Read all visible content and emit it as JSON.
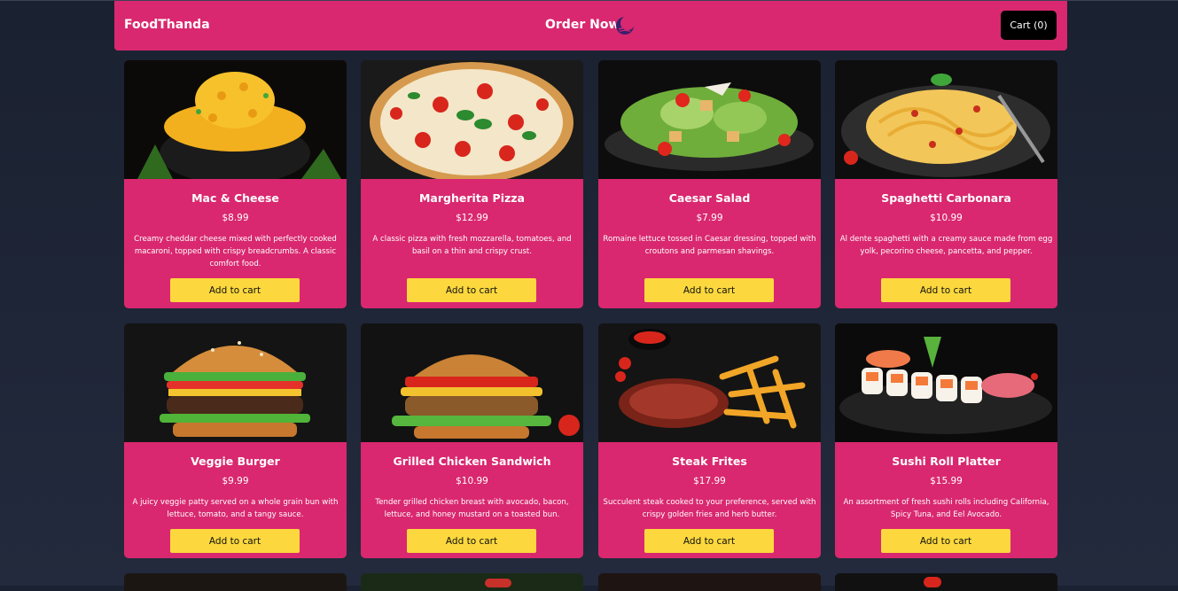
{
  "navbar": {
    "brand": "FoodThanda",
    "center_title": "Order Now",
    "cart_label": "Cart (0)"
  },
  "colors": {
    "accent": "#d9286f",
    "button": "#fcd83e",
    "background": "#1f2638"
  },
  "menu": [
    {
      "name": "Mac & Cheese",
      "price": "$8.99",
      "description": "Creamy cheddar cheese mixed with perfectly cooked macaroni, topped with crispy breadcrumbs. A classic comfort food.",
      "button": "Add to cart"
    },
    {
      "name": "Margherita Pizza",
      "price": "$12.99",
      "description": "A classic pizza with fresh mozzarella, tomatoes, and basil on a thin and crispy crust.",
      "button": "Add to cart"
    },
    {
      "name": "Caesar Salad",
      "price": "$7.99",
      "description": "Romaine lettuce tossed in Caesar dressing, topped with croutons and parmesan shavings.",
      "button": "Add to cart"
    },
    {
      "name": "Spaghetti Carbonara",
      "price": "$10.99",
      "description": "Al dente spaghetti with a creamy sauce made from egg yolk, pecorino cheese, pancetta, and pepper.",
      "button": "Add to cart"
    },
    {
      "name": "Veggie Burger",
      "price": "$9.99",
      "description": "A juicy veggie patty served on a whole grain bun with lettuce, tomato, and a tangy sauce.",
      "button": "Add to cart"
    },
    {
      "name": "Grilled Chicken Sandwich",
      "price": "$10.99",
      "description": "Tender grilled chicken breast with avocado, bacon, lettuce, and honey mustard on a toasted bun.",
      "button": "Add to cart"
    },
    {
      "name": "Steak Frites",
      "price": "$17.99",
      "description": "Succulent steak cooked to your preference, served with crispy golden fries and herb butter.",
      "button": "Add to cart"
    },
    {
      "name": "Sushi Roll Platter",
      "price": "$15.99",
      "description": "An assortment of fresh sushi rolls including California, Spicy Tuna, and Eel Avocado.",
      "button": "Add to cart"
    }
  ]
}
